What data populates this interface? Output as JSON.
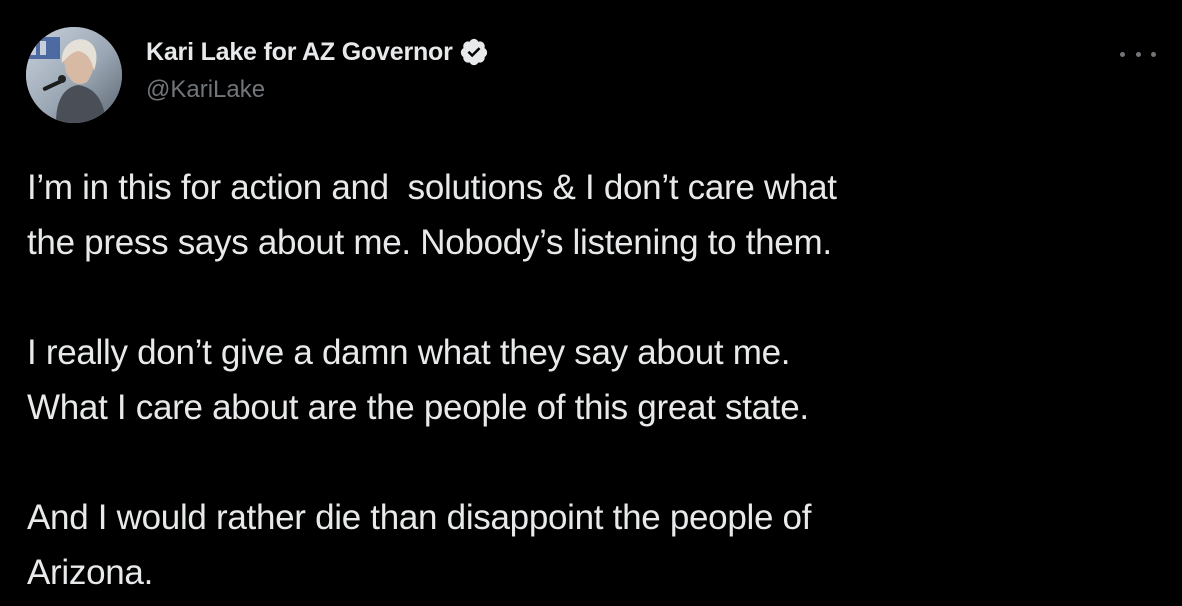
{
  "author": {
    "display_name": "Kari Lake for AZ Governor",
    "handle": "@KariLake",
    "verified": true,
    "avatar_icon": "profile-photo-avatar"
  },
  "actions": {
    "more_icon": "more-dots-icon"
  },
  "tweet": {
    "paragraphs": [
      {
        "lines": [
          "I’m in this for action and  solutions & I don’t care what",
          "the press says about me. Nobody’s listening to them."
        ]
      },
      {
        "lines": [
          "I really don’t give a damn what they say about me.",
          "What I care about are the people of this great state."
        ]
      },
      {
        "lines": [
          "And I would rather die than disappoint the people of",
          "Arizona."
        ]
      }
    ]
  },
  "colors": {
    "background": "#000000",
    "text_primary": "#e7e9ea",
    "text_secondary": "#71767b",
    "verified_badge": "#e7e9ea"
  }
}
